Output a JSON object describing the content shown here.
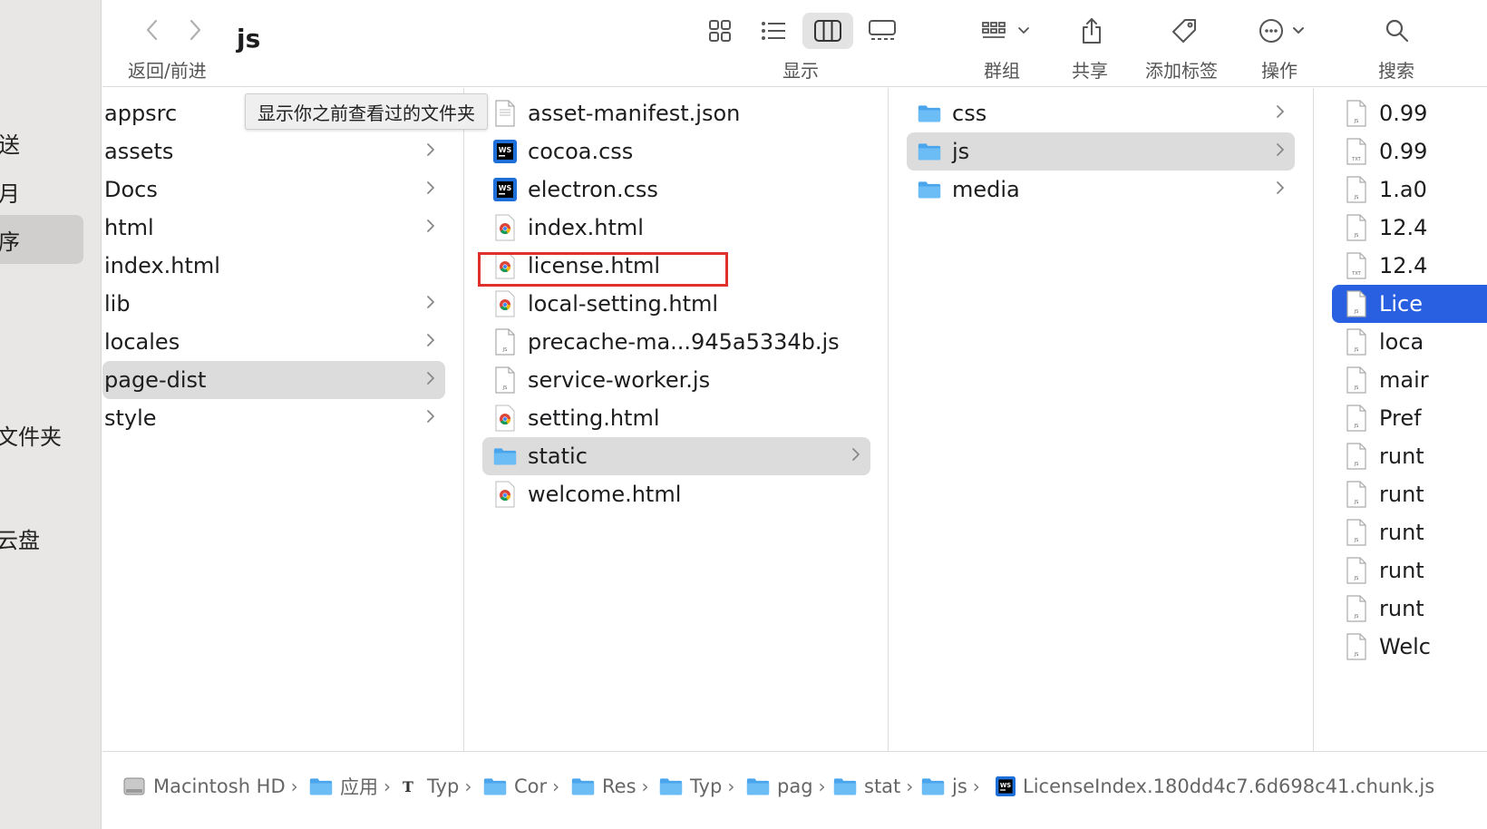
{
  "sidebar": {
    "items": [
      {
        "label": "送"
      },
      {
        "label": "月"
      },
      {
        "label": "序"
      },
      {
        "label": "文件夹"
      },
      {
        "label": "云盘"
      }
    ]
  },
  "toolbar": {
    "title": "js",
    "nav_label": "返回/前进",
    "view_label": "显示",
    "group_label": "群组",
    "share_label": "共享",
    "tag_label": "添加标签",
    "action_label": "操作",
    "search_label": "搜索",
    "tooltip": "显示你之前查看过的文件夹"
  },
  "columns": {
    "col1": [
      "appsrc",
      "assets",
      "Docs",
      "html",
      "index.html",
      "lib",
      "locales",
      "page-dist",
      "style"
    ],
    "col2": [
      "asset-manifest.json",
      "cocoa.css",
      "electron.css",
      "index.html",
      "license.html",
      "local-setting.html",
      "precache-ma...945a5334b.js",
      "service-worker.js",
      "setting.html",
      "static",
      "welcome.html"
    ],
    "col3": [
      "css",
      "js",
      "media"
    ],
    "col4": [
      "0.99",
      "0.99",
      "1.a0",
      "12.4",
      "12.4",
      "Lice",
      "loca",
      "mair",
      "Pref",
      "runt",
      "runt",
      "runt",
      "runt",
      "runt",
      "Welc"
    ]
  },
  "pathbar": {
    "crumbs": [
      "Macintosh HD",
      "应用",
      "Typ",
      "Cor",
      "Res",
      "Typ",
      "pag",
      "stat",
      "js",
      "LicenseIndex.180dd4c7.6d698c41.chunk.js"
    ]
  },
  "colors": {
    "selection_blue": "#2860e1",
    "selection_grey": "#dcdcdc",
    "highlight_red": "#e0302b",
    "folder_blue": "#5ab0f0"
  }
}
